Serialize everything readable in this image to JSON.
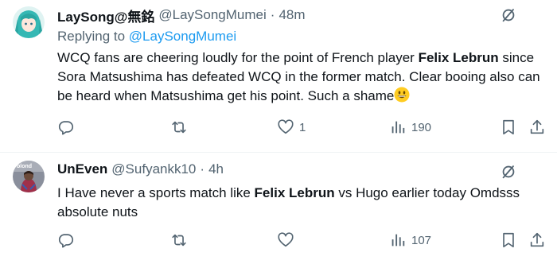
{
  "tweets": [
    {
      "display_name": "LaySong@無銘",
      "handle": "@LaySongMumei",
      "separator": "·",
      "time": "48m",
      "reply_prefix": "Replying to",
      "reply_handle": "@LaySongMumei",
      "body": {
        "p1": "WCQ fans are cheering loudly for the point of French player ",
        "b1": "Felix Lebrun",
        "p2": " since Sora Matsushima has defeated WCQ in the former match. Clear booing also can be heard when Matsushima get his point. Such a shame",
        "emoji": "grinning-face-emoji"
      },
      "replies": "",
      "retweets": "",
      "likes": "1",
      "views": "190"
    },
    {
      "display_name": "UnEven",
      "handle": "@Sufyankk10",
      "separator": "·",
      "time": "4h",
      "avatar_text": "blond",
      "body": {
        "p1": "I Have never a sports match like ",
        "b1": "Felix Lebrun",
        "p2": " vs Hugo earlier today Omdsss absolute nuts"
      },
      "replies": "",
      "retweets": "",
      "likes": "",
      "views": "107"
    }
  ],
  "icons": {
    "more": "grok-slash-icon",
    "reply": "reply-icon",
    "retweet": "retweet-icon",
    "like": "heart-icon",
    "views": "views-bar-chart-icon",
    "bookmark": "bookmark-icon",
    "share": "share-icon"
  },
  "colors": {
    "text_primary": "#0f1419",
    "text_secondary": "#536471",
    "link": "#1d9bf0",
    "divider": "#eff3f4"
  }
}
